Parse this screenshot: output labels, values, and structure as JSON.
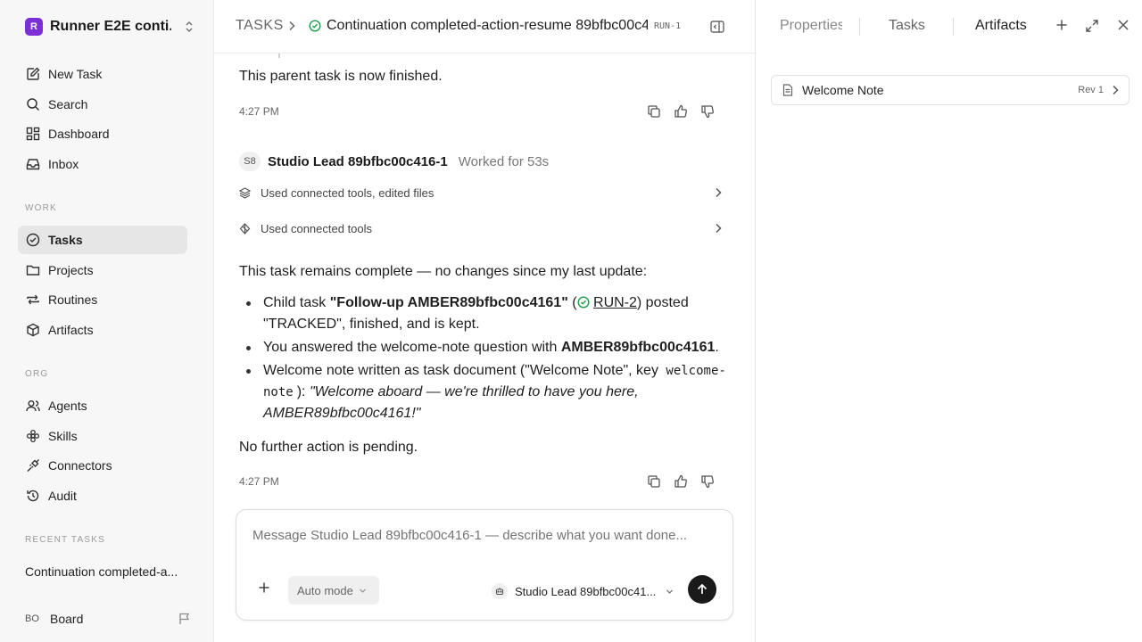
{
  "workspace": {
    "logo_letter": "R",
    "name": "Runner E2E conti..."
  },
  "sidebar": {
    "primary": [
      {
        "label": "New Task",
        "icon": "edit-icon"
      },
      {
        "label": "Search",
        "icon": "search-icon"
      },
      {
        "label": "Dashboard",
        "icon": "dashboard-icon"
      },
      {
        "label": "Inbox",
        "icon": "inbox-icon"
      }
    ],
    "work_label": "WORK",
    "work": [
      {
        "label": "Tasks",
        "icon": "check-circle-icon",
        "active": true
      },
      {
        "label": "Projects",
        "icon": "folder-icon"
      },
      {
        "label": "Routines",
        "icon": "repeat-icon"
      },
      {
        "label": "Artifacts",
        "icon": "cube-icon"
      }
    ],
    "org_label": "ORG",
    "org": [
      {
        "label": "Agents",
        "icon": "users-icon"
      },
      {
        "label": "Skills",
        "icon": "flower-icon"
      },
      {
        "label": "Connectors",
        "icon": "plug-icon"
      },
      {
        "label": "Audit",
        "icon": "history-icon"
      }
    ],
    "recent_label": "RECENT TASKS",
    "recent_tasks": [
      "Continuation completed-a..."
    ],
    "user": {
      "initials": "BO",
      "name": "Board"
    }
  },
  "header": {
    "root": "TASKS",
    "title": "Continuation completed-action-resume 89bfbc00c4...",
    "run_id": "RUN-1"
  },
  "thread": {
    "finished_text": "This parent task is now finished.",
    "time_1": "4:27 PM",
    "agent_initials": "S8",
    "agent_name": "Studio Lead 89bfbc00c416-1",
    "worked_for": "Worked for 53s",
    "tool_rows": [
      "Used connected tools, edited files",
      "Used connected tools"
    ],
    "summary_intro": "This task remains complete — no changes since my last update:",
    "b1_pre": "Child task ",
    "b1_bold": "\"Follow-up AMBER89bfbc00c4161\"",
    "b1_open": " (",
    "b1_link": "RUN-2",
    "b1_post": ") posted \"TRACKED\", finished, and is kept.",
    "b2_pre": "You answered the welcome-note question with ",
    "b2_bold": "AMBER89bfbc00c4161",
    "b2_post": ".",
    "b3_pre": "Welcome note written as task document (\"Welcome Note\", key ",
    "b3_code": "welcome-note",
    "b3_mid": "): ",
    "b3_italic": "\"Welcome aboard — we're thrilled to have you here, AMBER89bfbc00c4161!\"",
    "closing": "No further action is pending.",
    "time_2": "4:27 PM"
  },
  "composer": {
    "placeholder": "Message Studio Lead 89bfbc00c416-1 — describe what you want done...",
    "mode_label": "Auto mode",
    "agent_label": "Studio Lead 89bfbc00c41..."
  },
  "right_panel": {
    "tabs": [
      "Properties",
      "Tasks",
      "Artifacts"
    ],
    "active_tab": "Artifacts",
    "artifacts": [
      {
        "name": "Welcome Note",
        "rev": "Rev 1"
      }
    ]
  }
}
